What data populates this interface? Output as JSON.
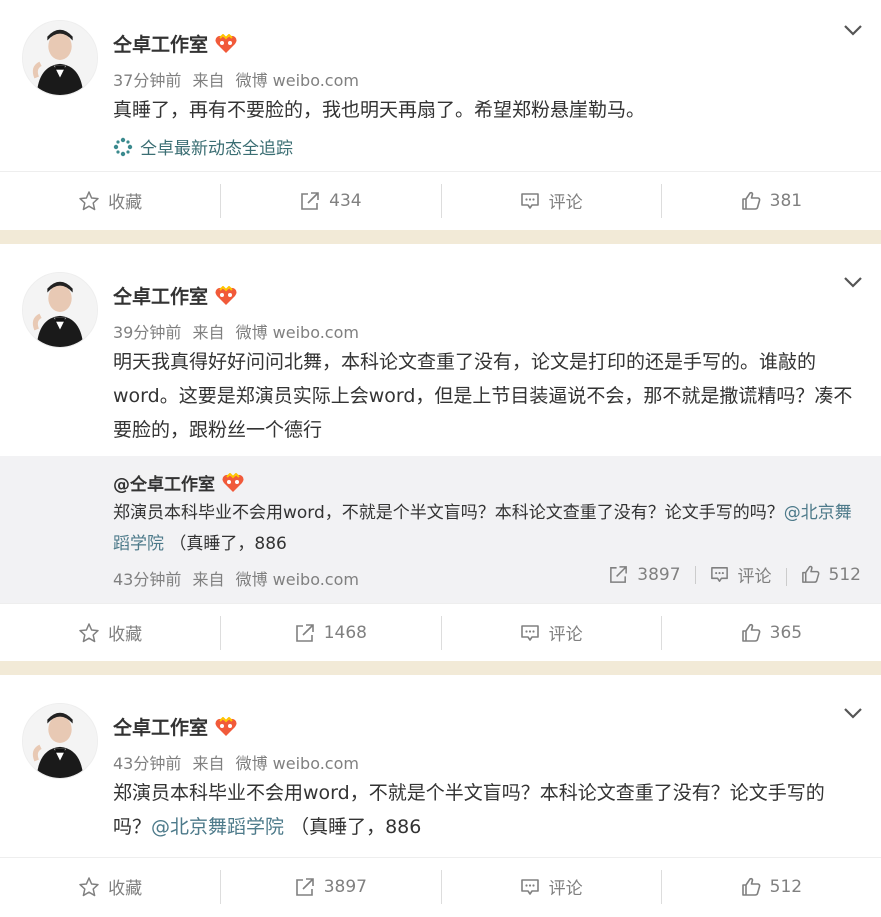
{
  "posts": [
    {
      "author": "仝卓工作室",
      "time": "37分钟前",
      "source_prefix": "来自",
      "source": "微博 weibo.com",
      "text": "真睡了，再有不要脸的，我也明天再扇了。希望郑粉悬崖勒马。",
      "follow_link": "仝卓最新动态全追踪",
      "actions": {
        "favorite": "收藏",
        "repost": "434",
        "comment": "评论",
        "like": "381"
      }
    },
    {
      "author": "仝卓工作室",
      "time": "39分钟前",
      "source_prefix": "来自",
      "source": "微博 weibo.com",
      "text": "明天我真得好好问问北舞，本科论文查重了没有，论文是打印的还是手写的。谁敲的word。这要是郑演员实际上会word，但是上节目装逼说不会，那不就是撒谎精吗？凑不要脸的，跟粉丝一个德行",
      "quote": {
        "author": "@仝卓工作室",
        "text_a": "郑演员本科毕业不会用word，不就是个半文盲吗？本科论文查重了没有？论文手写的吗？",
        "mention": "@北京舞蹈学院",
        "text_b": " （真睡了，886",
        "time": "43分钟前",
        "source_prefix": "来自",
        "source": "微博 weibo.com",
        "repost": "3897",
        "comment": "评论",
        "like": "512"
      },
      "actions": {
        "favorite": "收藏",
        "repost": "1468",
        "comment": "评论",
        "like": "365"
      }
    },
    {
      "author": "仝卓工作室",
      "time": "43分钟前",
      "source_prefix": "来自",
      "source": "微博 weibo.com",
      "text_a": "郑演员本科毕业不会用word，不就是个半文盲吗？本科论文查重了没有？论文手写的吗？",
      "mention": "@北京舞蹈学院",
      "text_b": " （真睡了，886",
      "actions": {
        "favorite": "收藏",
        "repost": "3897",
        "comment": "评论",
        "like": "512"
      }
    }
  ],
  "icons": {
    "favorite": "star-icon",
    "repost": "share-icon",
    "comment": "comment-icon",
    "like": "thumbs-up-icon",
    "menu": "chevron-down-icon",
    "badge": "verified-heart-badge-icon",
    "follow": "super-topic-icon"
  },
  "colors": {
    "background": "#f2ead7",
    "mention": "#4d7a8a",
    "meta": "#808080",
    "quote_bg": "#f2f2f4"
  }
}
